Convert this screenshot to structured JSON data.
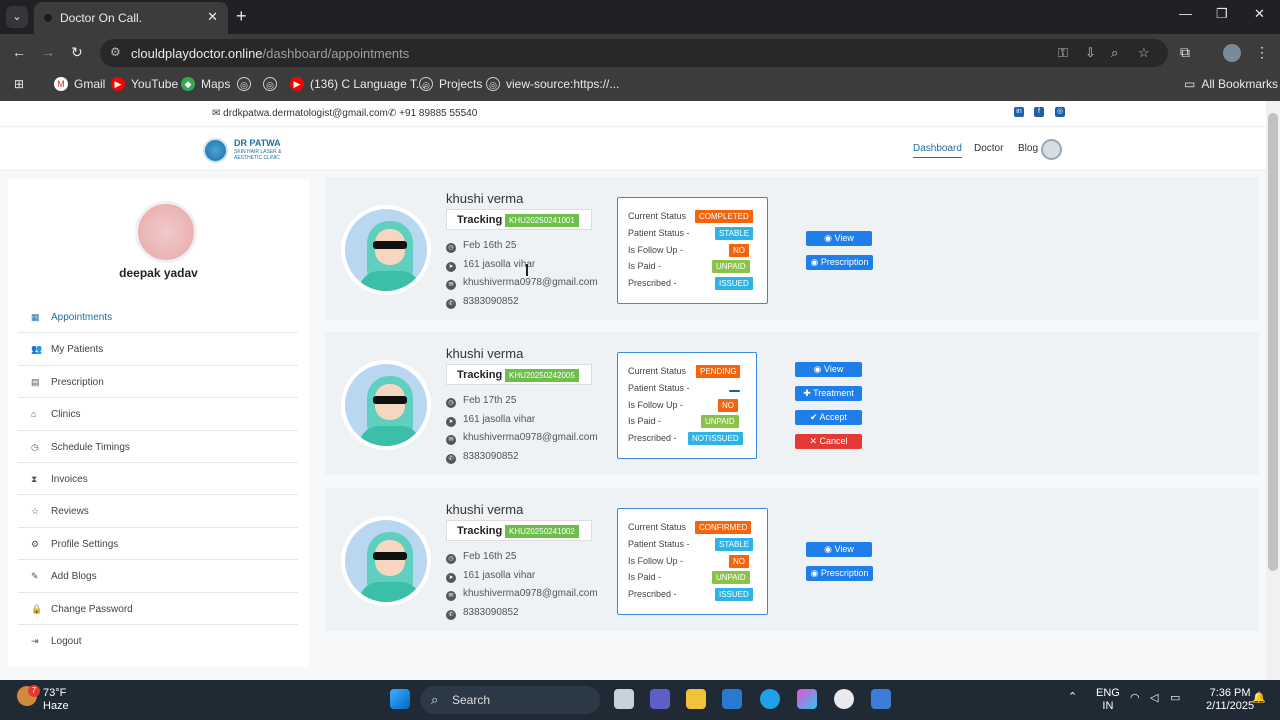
{
  "browser": {
    "tab_title": "Doctor On Call.",
    "url_host": "clouldplaydoctor.online",
    "url_path": "/dashboard/appointments",
    "bookmarks": [
      {
        "label": "Gmail",
        "icon": "gmail-icon"
      },
      {
        "label": "YouTube",
        "icon": "youtube-icon"
      },
      {
        "label": "Maps",
        "icon": "maps-icon"
      },
      {
        "label": "",
        "icon": "globe-icon"
      },
      {
        "label": "",
        "icon": "globe-icon"
      },
      {
        "label": "(136) C Language T...",
        "icon": "youtube-icon"
      },
      {
        "label": "Projects",
        "icon": "globe-icon"
      },
      {
        "label": "view-source:https://...",
        "icon": "globe-icon"
      }
    ],
    "all_bookmarks": "All Bookmarks"
  },
  "topbar": {
    "email": "drdkpatwa.dermatologist@gmail.com",
    "phone": "+91 89885 55540",
    "social_icons": [
      "linkedin-icon",
      "facebook-icon",
      "instagram-icon"
    ]
  },
  "header": {
    "logo_title": "DR PATWA",
    "logo_subtitle": "SKIN HAIR LASER & AESTHETIC CLINIC",
    "nav": [
      "Dashboard",
      "Doctor",
      "Blog"
    ],
    "active_nav": "Dashboard"
  },
  "sidebar": {
    "profile_name": "deepak yadav",
    "items": [
      {
        "label": "Appointments",
        "icon": "calendar-icon",
        "active": true
      },
      {
        "label": "My Patients",
        "icon": "patients-icon",
        "active": false
      },
      {
        "label": "Prescription",
        "icon": "prescription-icon",
        "active": false
      },
      {
        "label": "Clinics",
        "icon": "clinic-icon",
        "active": false
      },
      {
        "label": "Schedule Timings",
        "icon": "clock-icon",
        "active": false
      },
      {
        "label": "Invoices",
        "icon": "hourglass-icon",
        "active": false
      },
      {
        "label": "Reviews",
        "icon": "reviews-icon",
        "active": false
      },
      {
        "label": "Profile Settings",
        "icon": "user-cog-icon",
        "active": false
      },
      {
        "label": "Add Blogs",
        "icon": "blog-icon",
        "active": false
      },
      {
        "label": "Change Password",
        "icon": "lock-icon",
        "active": false
      },
      {
        "label": "Logout",
        "icon": "logout-icon",
        "active": false
      }
    ]
  },
  "status_labels": {
    "current_status": "Current Status",
    "patient_status": "Patient Status -",
    "follow_up": "Is Follow Up -",
    "is_paid": "Is Paid -",
    "prescribed": "Prescribed -"
  },
  "tracking_label": "Tracking",
  "appointments": [
    {
      "name": "khushi verma",
      "tracking_id": "KHU20250241001",
      "date": "Feb 16th 25",
      "address": "161 jasolla vihar",
      "email": "khushiverma0978@gmail.com",
      "phone": "8383090852",
      "current_status": "COMPLETED",
      "patient_status": "STABLE",
      "follow_up": "NO",
      "paid": "UNPAID",
      "prescribed": "ISSUED",
      "actions": [
        "View",
        "Prescription"
      ]
    },
    {
      "name": "khushi verma",
      "tracking_id": "KHU20250242005",
      "date": "Feb 17th 25",
      "address": "161 jasolla vihar",
      "email": "khushiverma0978@gmail.com",
      "phone": "8383090852",
      "current_status": "PENDING",
      "patient_status": "",
      "follow_up": "NO",
      "paid": "UNPAID",
      "prescribed": "NOTISSUED",
      "actions": [
        "View",
        "Treatment",
        "Accept",
        "Cancel"
      ]
    },
    {
      "name": "khushi verma",
      "tracking_id": "KHU20250241002",
      "date": "Feb 16th 25",
      "address": "161 jasolla vihar",
      "email": "khushiverma0978@gmail.com",
      "phone": "8383090852",
      "current_status": "CONFIRMED",
      "patient_status": "STABLE",
      "follow_up": "NO",
      "paid": "UNPAID",
      "prescribed": "ISSUED",
      "actions": [
        "View",
        "Prescription"
      ]
    }
  ],
  "taskbar": {
    "temperature": "73°F",
    "weather": "Haze",
    "search_placeholder": "Search",
    "lang_line1": "ENG",
    "lang_line2": "IN",
    "time": "7:36 PM",
    "date": "2/11/2025",
    "notif_badge": "7"
  },
  "colors": {
    "accent": "#1d6fa5",
    "status_orange": "#f4640c",
    "status_blue": "#2fb3e6",
    "status_green": "#8bc34a",
    "button_blue": "#1f7ee8",
    "button_red": "#e53935"
  }
}
